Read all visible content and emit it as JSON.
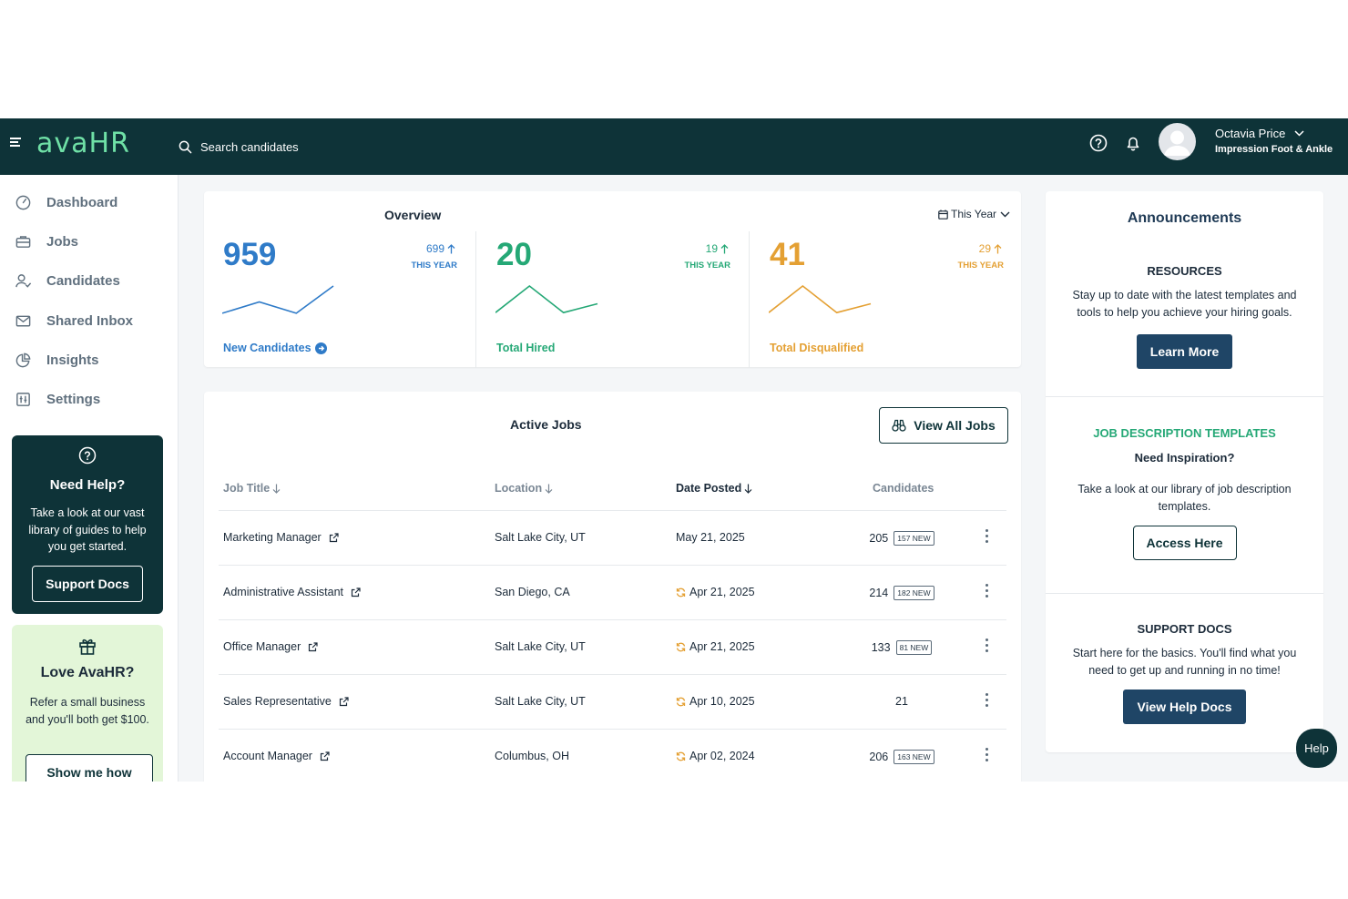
{
  "colors": {
    "topbar": "#0e3338",
    "brand": "#6fe0a6",
    "new_candidates": "#2f7bc8",
    "hired": "#25a876",
    "disqualified": "#e4a033",
    "button_dark": "#1f4566",
    "refer_card": "#e3f6d8"
  },
  "topbar": {
    "logo": "avaHR",
    "search_placeholder": "Search candidates",
    "user_name": "Octavia Price",
    "user_org": "Impression Foot & Ankle"
  },
  "sidebar": {
    "items": [
      {
        "label": "Dashboard",
        "icon": "dashboard-gauge-icon"
      },
      {
        "label": "Jobs",
        "icon": "briefcase-icon"
      },
      {
        "label": "Candidates",
        "icon": "user-check-icon"
      },
      {
        "label": "Shared Inbox",
        "icon": "mail-icon"
      },
      {
        "label": "Insights",
        "icon": "pie-chart-icon"
      },
      {
        "label": "Settings",
        "icon": "sliders-icon"
      }
    ],
    "help_card": {
      "title": "Need Help?",
      "text": "Take a look at our vast library of guides to help you get started.",
      "button": "Support Docs"
    },
    "refer_card": {
      "title": "Love AvaHR?",
      "text": "Refer a small business and you'll both get $100.",
      "button": "Show me how"
    }
  },
  "overview": {
    "title": "Overview",
    "period": "This Year",
    "stats": [
      {
        "value": "959",
        "change": "699",
        "period": "THIS YEAR",
        "label": "New Candidates",
        "color": "#2f7bc8",
        "trend": [
          2,
          14,
          2,
          31
        ]
      },
      {
        "value": "20",
        "change": "19",
        "period": "THIS YEAR",
        "label": "Total Hired",
        "color": "#25a876",
        "trend": [
          2,
          23,
          2,
          9
        ]
      },
      {
        "value": "41",
        "change": "29",
        "period": "THIS YEAR",
        "label": "Total Disqualified",
        "color": "#e4a033",
        "trend": [
          2,
          23,
          2,
          9
        ]
      }
    ]
  },
  "jobs": {
    "title": "Active Jobs",
    "view_all": "View All Jobs",
    "columns": [
      "Job Title",
      "Location",
      "Date Posted",
      "Candidates"
    ],
    "rows": [
      {
        "title": "Marketing Manager",
        "location": "Salt Lake City, UT",
        "date": "May 21, 2025",
        "refresh": false,
        "candidates": "205",
        "new": "157 NEW"
      },
      {
        "title": "Administrative Assistant",
        "location": "San Diego, CA",
        "date": "Apr 21, 2025",
        "refresh": true,
        "candidates": "214",
        "new": "182 NEW"
      },
      {
        "title": "Office Manager",
        "location": "Salt Lake City, UT",
        "date": "Apr 21, 2025",
        "refresh": true,
        "candidates": "133",
        "new": "81 NEW"
      },
      {
        "title": "Sales Representative",
        "location": "Salt Lake City, UT",
        "date": "Apr 10, 2025",
        "refresh": true,
        "candidates": "21",
        "new": ""
      },
      {
        "title": "Account Manager",
        "location": "Columbus, OH",
        "date": "Apr 02, 2024",
        "refresh": true,
        "candidates": "206",
        "new": "163 NEW"
      }
    ]
  },
  "announcements": {
    "title": "Announcements",
    "resources": {
      "heading": "RESOURCES",
      "text": "Stay up to date with the latest templates and tools to help you achieve your hiring goals.",
      "button": "Learn More"
    },
    "templates": {
      "heading": "JOB DESCRIPTION TEMPLATES",
      "subheading": "Need Inspiration?",
      "text": "Take a look at our library of job description templates.",
      "button": "Access Here"
    },
    "support": {
      "heading": "SUPPORT DOCS",
      "text": "Start here for the basics. You'll find what you need to get up and running in no time!",
      "button": "View Help Docs"
    }
  },
  "help_fab": "Help"
}
